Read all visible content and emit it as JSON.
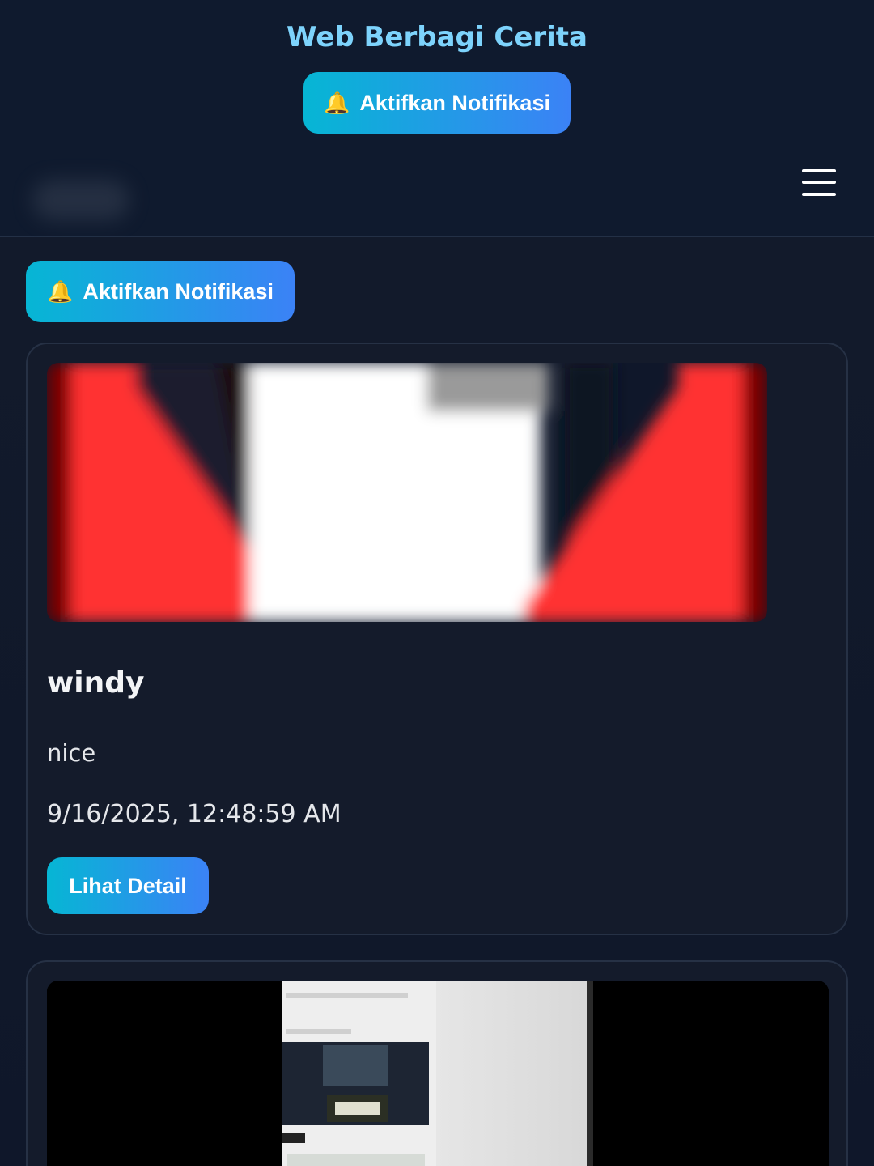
{
  "header": {
    "title": "Web Berbagi Cerita",
    "notify_label": "Aktifkan Notifikasi",
    "notify_icon": "bell-icon"
  },
  "main": {
    "notify_label": "Aktifkan Notifikasi"
  },
  "stories": [
    {
      "name": "windy",
      "description": "nice",
      "date": "9/16/2025, 12:48:59 AM",
      "detail_label": "Lihat Detail"
    }
  ],
  "colors": {
    "accent_start": "#06b6d4",
    "accent_end": "#3b82f6",
    "title": "#7dd3fc",
    "background": "#0f172a",
    "card": "#141b2b"
  }
}
